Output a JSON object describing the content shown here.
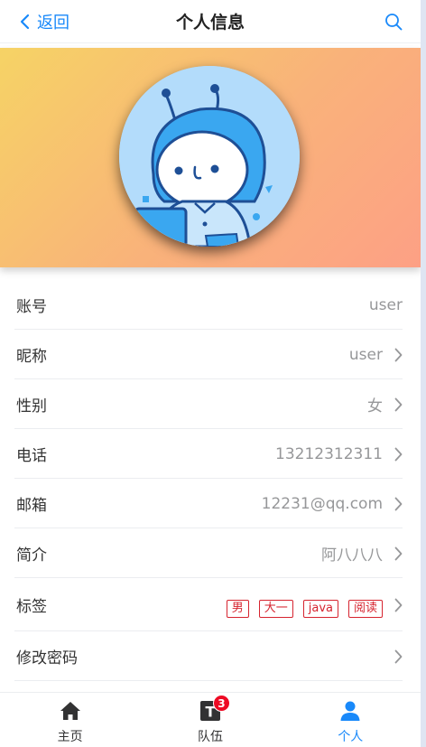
{
  "navbar": {
    "back_label": "返回",
    "title": "个人信息",
    "search_icon": "search-icon"
  },
  "profile": {
    "avatar": "cartoon-astronaut-avatar"
  },
  "fields": [
    {
      "label": "账号",
      "value": "user",
      "arrow": false
    },
    {
      "label": "昵称",
      "value": "user",
      "arrow": true
    },
    {
      "label": "性别",
      "value": "女",
      "arrow": true
    },
    {
      "label": "电话",
      "value": "13212312311",
      "arrow": true
    },
    {
      "label": "邮箱",
      "value": "12231@qq.com",
      "arrow": true
    },
    {
      "label": "简介",
      "value": "阿八八八",
      "arrow": true
    },
    {
      "label": "标签",
      "tags": [
        "男",
        "大一",
        "java",
        "阅读"
      ],
      "arrow": true
    },
    {
      "label": "修改密码",
      "value": "",
      "arrow": true
    }
  ],
  "tabbar": {
    "items": [
      {
        "label": "主页",
        "icon": "home-icon",
        "active": false
      },
      {
        "label": "队伍",
        "icon": "team-icon",
        "badge": "3",
        "active": false
      },
      {
        "label": "个人",
        "icon": "user-icon",
        "active": true
      }
    ]
  },
  "colors": {
    "accent": "#1989fa",
    "tag": "#d6242f",
    "badge": "#ee0a24",
    "banner_start": "#f6d365",
    "banner_end": "#fda085"
  }
}
